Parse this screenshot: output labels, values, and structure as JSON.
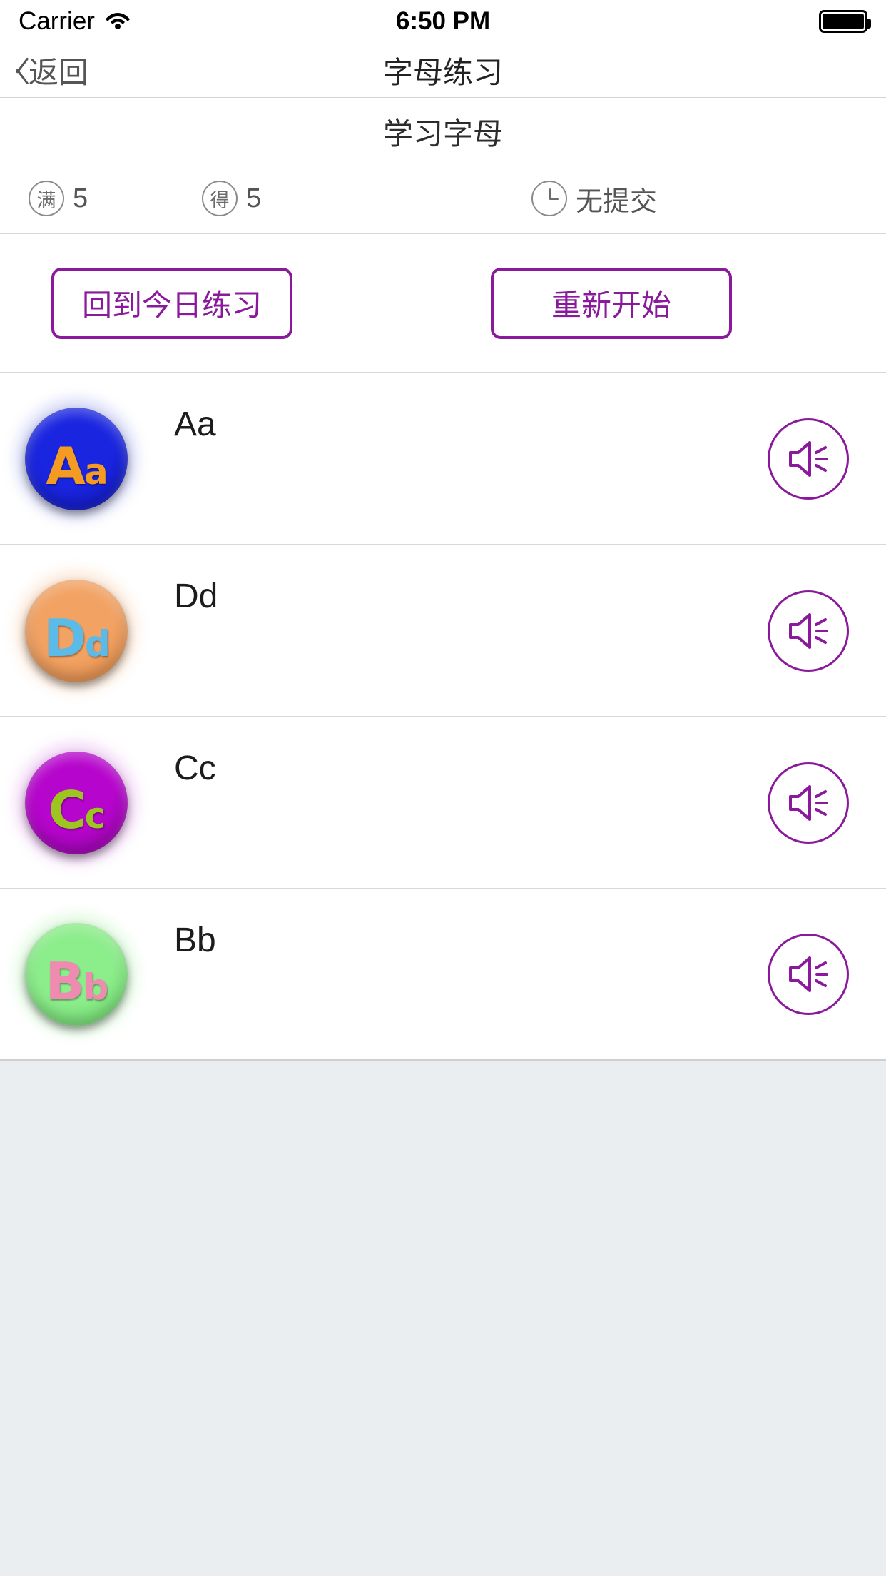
{
  "status_bar": {
    "carrier": "Carrier",
    "wifi_icon": "wifi-icon",
    "time": "6:50 PM",
    "battery_icon": "battery-full-icon"
  },
  "nav_bar": {
    "back_icon": "chevron-left-icon",
    "back_label": "返回",
    "title": "字母练习"
  },
  "subtitle": {
    "text": "学习字母"
  },
  "stats": [
    {
      "badge": "满",
      "value": "5",
      "icon": ""
    },
    {
      "badge": "得",
      "value": "5",
      "icon": ""
    },
    {
      "badge": "",
      "value": "无提交",
      "icon": "clock-icon"
    }
  ],
  "actions": [
    {
      "label": "回到今日练习"
    },
    {
      "label": "重新开始"
    }
  ],
  "letters": [
    {
      "label": "Aa",
      "big": "A",
      "small": "a",
      "bg": "#1a25e0",
      "bg2": "#0f17b8",
      "glow": "#b9c0f2",
      "art_color": "#f59b22",
      "speaker_icon": "speaker-icon"
    },
    {
      "label": "Dd",
      "big": "D",
      "small": "d",
      "bg": "#f2a263",
      "bg2": "#e08b46",
      "glow": "#fbd9bd",
      "art_color": "#5bbbe8",
      "speaker_icon": "speaker-icon"
    },
    {
      "label": "Cc",
      "big": "C",
      "small": "c",
      "bg": "#b605cc",
      "bg2": "#9504a8",
      "glow": "#e9b8f0",
      "art_color": "#9cc51f",
      "speaker_icon": "speaker-icon"
    },
    {
      "label": "Bb",
      "big": "B",
      "small": "b",
      "bg": "#8ced8b",
      "bg2": "#6edc6d",
      "glow": "#cdf7cc",
      "art_color": "#ef8ab0",
      "speaker_icon": "speaker-icon"
    }
  ],
  "colors": {
    "accent_purple": "#8a1a9b",
    "page_background": "#eaeef0",
    "card_background": "#ffffff",
    "separator": "#d8d8d8"
  }
}
